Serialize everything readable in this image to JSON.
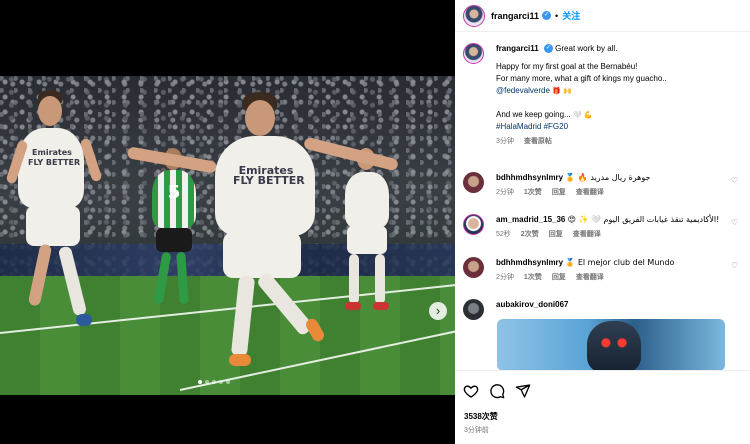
{
  "post": {
    "username": "frangarci11",
    "follow_label": "关注",
    "separator": "•",
    "verified_glyph": "✓"
  },
  "media": {
    "jersey_main": "Emirates\nFLY BETTER",
    "jersey_left": "Emirates\nFLY BETTER",
    "green_number": "5",
    "next_icon": "chevron-right-icon",
    "next_glyph": "›",
    "carousel_dots": 5,
    "active_dot": 0
  },
  "caption": {
    "username": "frangarci11",
    "first_line": "Great work by all.",
    "line2": "Happy for my first goal at the Bernabéu!",
    "line3": "For many more, what a gift of kings my guacho..",
    "mention": "@fedevalverde",
    "mention_emoji": "🎁 🙌",
    "line5": "And we keep going...",
    "line5_emoji": "🤍 💪",
    "hashtags": "#HalaMadrid #FG20",
    "time": "3分钟",
    "see_translation": "查看原帖"
  },
  "comments": [
    {
      "username": "bdhhmdhsynlmry",
      "text": "🏅 🔥 جوهرة ريال مدريد",
      "time": "2分钟",
      "likes": "1次赞",
      "reply": "回复",
      "translate": "查看翻译"
    },
    {
      "username": "am_madrid_15_36",
      "text": "😍 ✨ 🤍 الأكاديمية تنقذ غيابات الفريق اليوم!",
      "time": "52秒",
      "likes": "2次赞",
      "reply": "回复",
      "translate": "查看翻译"
    },
    {
      "username": "bdhhmdhsynlmry",
      "text": "🏅 El mejor club del Mundo",
      "time": "2分钟",
      "likes": "1次赞",
      "reply": "回复",
      "translate": "查看翻译"
    },
    {
      "username": "aubakirov_doni067",
      "text": "",
      "time": "",
      "likes": "",
      "reply": "",
      "translate": ""
    }
  ],
  "actions": {
    "like_icon": "heart-icon",
    "comment_icon": "comment-icon",
    "share_icon": "share-icon",
    "likes_count": "3538次赞",
    "time_ago": "3分钟前"
  },
  "colors": {
    "link": "#00376b",
    "follow": "#0095f6",
    "muted": "#737373"
  }
}
